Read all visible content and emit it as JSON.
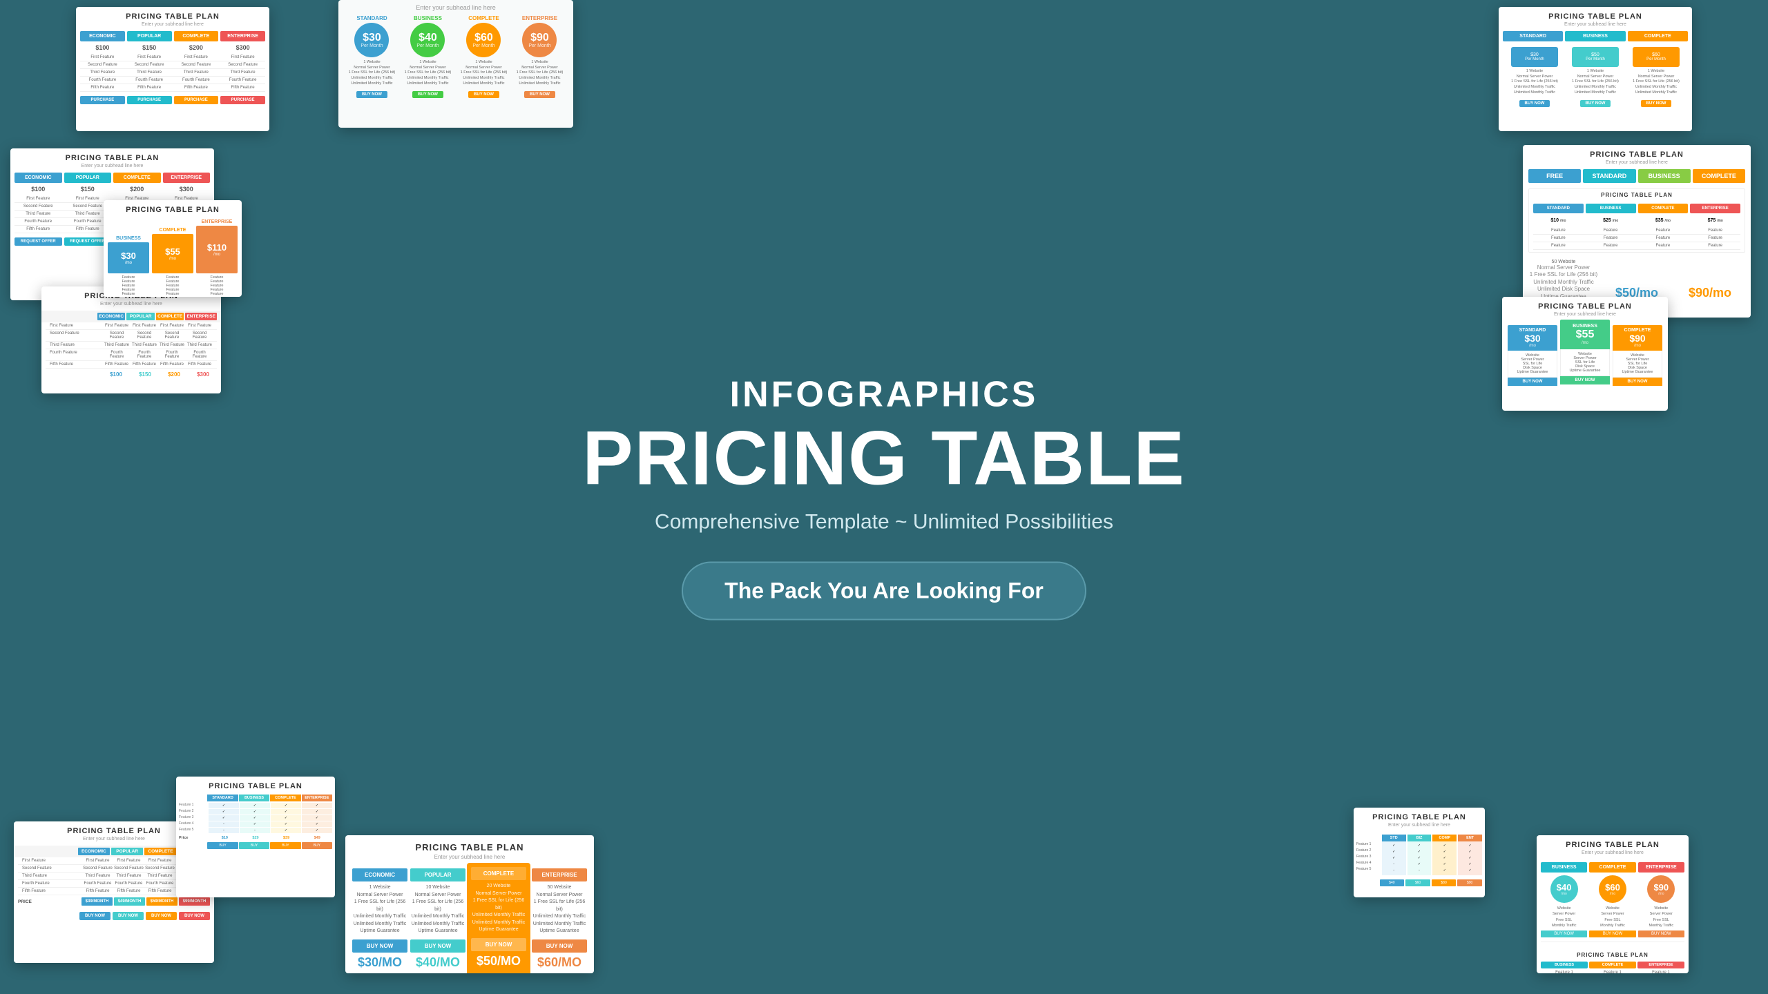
{
  "hero": {
    "infographics": "INFOGRAPHICS",
    "pricing_table": "PRICING TABLE",
    "subtitle": "Comprehensive Template ~ Unlimited Possibilities",
    "cta": "The Pack You Are Looking For"
  },
  "colors": {
    "blue": "#3ca0d0",
    "teal": "#2bbccc",
    "green": "#44cccc",
    "orange": "#ff9900",
    "yellow": "#ffaa00",
    "red": "#ee5544",
    "lime": "#88cc44",
    "enterprise": "#ee6622"
  },
  "cards": {
    "card1": {
      "title": "PRICING TABLE PLAN",
      "subtitle": "Enter your subhead line here",
      "plans": [
        "ECONOMIC",
        "POPULAR",
        "COMPLETE",
        "ENTERPRISE"
      ],
      "prices": [
        "$100",
        "$150",
        "$200",
        "$300"
      ],
      "features": [
        [
          "First Feature",
          "First Feature",
          "First Feature",
          "First Feature"
        ],
        [
          "Second Feature",
          "Second Feature",
          "Second Feature",
          "Second Feature"
        ],
        [
          "Third Feature",
          "Third Feature",
          "Third Feature",
          "Third Feature"
        ],
        [
          "Fourth Feature",
          "Fourth Feature",
          "Fourth Feature",
          "Fourth Feature"
        ],
        [
          "Fifth Feature",
          "Fifth Feature",
          "Fifth Feature",
          "Fifth Feature"
        ]
      ],
      "buttons": [
        "PURCHASE",
        "PURCHASE",
        "PURCHASE",
        "PURCHASE"
      ]
    }
  },
  "complete_badge": "COMPLETE"
}
